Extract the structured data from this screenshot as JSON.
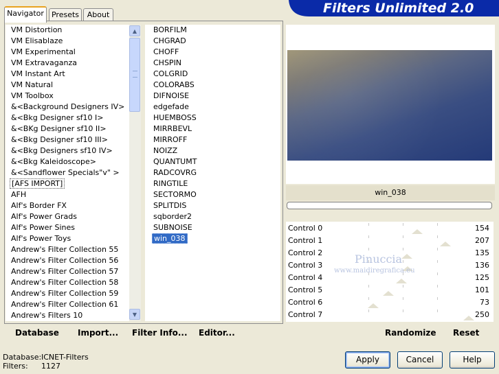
{
  "header": {
    "title": "Filters Unlimited 2.0",
    "banner_color": "#0a2aa8"
  },
  "tabs": [
    {
      "label": "Navigator",
      "active": true
    },
    {
      "label": "Presets",
      "active": false
    },
    {
      "label": "About",
      "active": false
    }
  ],
  "categories": [
    "VM Distortion",
    "VM Elisablaze",
    "VM Experimental",
    "VM Extravaganza",
    "VM Instant Art",
    "VM Natural",
    "VM Toolbox",
    "&<Background Designers IV>",
    "&<Bkg Designer sf10 I>",
    "&<BKg Designer sf10 II>",
    "&<Bkg Designer sf10 III>",
    "&<Bkg Designers sf10 IV>",
    "&<Bkg Kaleidoscope>",
    "&<Sandflower Specials\"v\" >",
    "[AFS IMPORT]",
    "AFH",
    "Alf's Border FX",
    "Alf's Power Grads",
    "Alf's Power Sines",
    "Alf's Power Toys",
    "Andrew's Filter Collection 55",
    "Andrew's Filter Collection 56",
    "Andrew's Filter Collection 57",
    "Andrew's Filter Collection 58",
    "Andrew's Filter Collection 59",
    "Andrew's Filter Collection 61",
    "Andrew's Filters 10"
  ],
  "focused_category": "[AFS IMPORT]",
  "filters": [
    "BORFILM",
    "CHGRAD",
    "CHOFF",
    "CHSPIN",
    "COLGRID",
    "COLORABS",
    "DIFNOISE",
    "edgefade",
    "HUEMBOSS",
    "MIRRBEVL",
    "MIRROFF",
    "NOIZZ",
    "QUANTUMT",
    "RADCOVRG",
    "RINGTILE",
    "SECTORMO",
    "SPLITDIS",
    "sqborder2",
    "SUBNOISE",
    "win_038"
  ],
  "selected_filter": "win_038",
  "left_buttons": {
    "database": "Database",
    "import": "Import...",
    "filter_info": "Filter Info...",
    "editor": "Editor..."
  },
  "preview": {
    "filter_name": "win_038",
    "progress": 0
  },
  "controls": [
    {
      "label": "Control 0",
      "value": 154
    },
    {
      "label": "Control 1",
      "value": 207
    },
    {
      "label": "Control 2",
      "value": 135
    },
    {
      "label": "Control 3",
      "value": 136
    },
    {
      "label": "Control 4",
      "value": 125
    },
    {
      "label": "Control 5",
      "value": 101
    },
    {
      "label": "Control 6",
      "value": 73
    },
    {
      "label": "Control 7",
      "value": 250
    }
  ],
  "control_max": 255,
  "watermark": {
    "name": "Pinuccia",
    "site": "www.maidiregrafica.eu"
  },
  "right_buttons": {
    "randomize": "Randomize",
    "reset": "Reset"
  },
  "status": {
    "database_label": "Database:",
    "database_value": "ICNET-Filters",
    "filters_label": "Filters:",
    "filters_value": "1127"
  },
  "dialog_buttons": {
    "apply": "Apply",
    "cancel": "Cancel",
    "help": "Help"
  },
  "colors": {
    "selection": "#316ac5",
    "dialog_bg": "#ece9d8"
  }
}
